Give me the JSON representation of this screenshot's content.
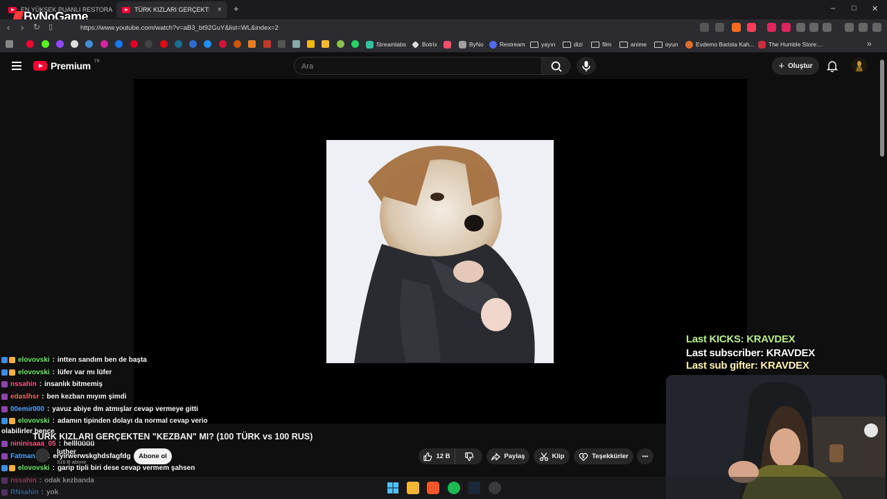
{
  "browser": {
    "tabs": [
      {
        "title": "EN YÜKSEK PUANLI RESTORANLAR",
        "active": false
      },
      {
        "title": "TÜRK KIZLARI GERÇEKTEN \"KEZB",
        "active": true
      }
    ],
    "brand_overlay": "ByNoGame",
    "url": "https://www.youtube.com/watch?v=aB3_bt92GuY&list=WL&index=2",
    "window_controls": [
      "–",
      "□",
      "✕"
    ],
    "new_tab": "+",
    "tab_close": "×",
    "bookmarks": [
      {
        "label": "Streamlabs",
        "color": "#31c3a2"
      },
      {
        "label": "Botrix",
        "color": "#dddddd"
      },
      {
        "label": "",
        "color": "#ff4d6d"
      },
      {
        "label": "ByNo",
        "color": "#a0a0a0"
      },
      {
        "label": "Restream",
        "color": "#4b6cff"
      },
      {
        "label": "yayın",
        "folder": true
      },
      {
        "label": "dizi",
        "folder": true
      },
      {
        "label": "film",
        "folder": true
      },
      {
        "label": "anime",
        "folder": true
      },
      {
        "label": "oyun",
        "folder": true
      },
      {
        "label": "Evdemo Barista Kah...",
        "color": "#e06b2b"
      },
      {
        "label": "The Humble Store:...",
        "color": "#cc2d3d"
      }
    ],
    "bookmark_more": "»"
  },
  "youtube": {
    "logo_text": "Premium",
    "logo_region": "TR",
    "search_placeholder": "Ara",
    "create_label": "Oluştur",
    "video": {
      "title": "TÜRK KIZLARI GERÇEKTEN \"KEZBAN\" MI? (100 TÜRK vs 100 RUS)",
      "channel": "luther",
      "subscribers": "316 B abone",
      "subscribe_label": "Abone ol",
      "likes": "12 B",
      "share_label": "Paylaş",
      "clip_label": "Klip",
      "thanks_label": "Teşekkürler",
      "more_label": "•••"
    }
  },
  "chat": [
    {
      "user": "elovovski",
      "color": "#6ff06f",
      "message": "intten sandım ben de başta"
    },
    {
      "user": "elovovski",
      "color": "#6ff06f",
      "message": "lüfer var mı lüfer"
    },
    {
      "user": "nssahin",
      "color": "#ff5c8a",
      "message": "insanlık bitmemiş"
    },
    {
      "user": "edaslhsr",
      "color": "#ff6b6b",
      "message": "ben kezban mıyım şimdi"
    },
    {
      "user": "00emir000",
      "color": "#5aa9ff",
      "message": "yavuz abiye dm atmışlar cevap vermeye gitti"
    },
    {
      "user": "elovovski",
      "color": "#6ff06f",
      "message": "adamın tipinden dolayı da normal cevap verio"
    },
    {
      "user": "",
      "color": "#ffffff",
      "message": "olabilirler bence"
    },
    {
      "user": "nininisaaa_05",
      "color": "#ff5c8a",
      "message": "helllüüüü"
    },
    {
      "user": "Fatmanrkz",
      "color": "#5aa9ff",
      "message": "eryirwerwskghdsfagfdg"
    },
    {
      "user": "elovovski",
      "color": "#6ff06f",
      "message": "garip tipli biri dese cevap vermem şahsen"
    },
    {
      "user": "nssahin",
      "color": "#ff5c8a",
      "message": "odak kezbanda"
    },
    {
      "user": "RNsahin",
      "color": "#5aa9ff",
      "message": "yok"
    }
  ],
  "stream_overlay": {
    "last_kicks": "Last KICKS: KRAVDEX",
    "last_subscriber": "Last subscriber: KRAVDEX",
    "last_sub_gifter": "Last sub gifter: KRAVDEX",
    "colors": {
      "kicks": "#b9f28a",
      "subscriber": "#ffffff",
      "gifter": "#fff3b0"
    }
  }
}
